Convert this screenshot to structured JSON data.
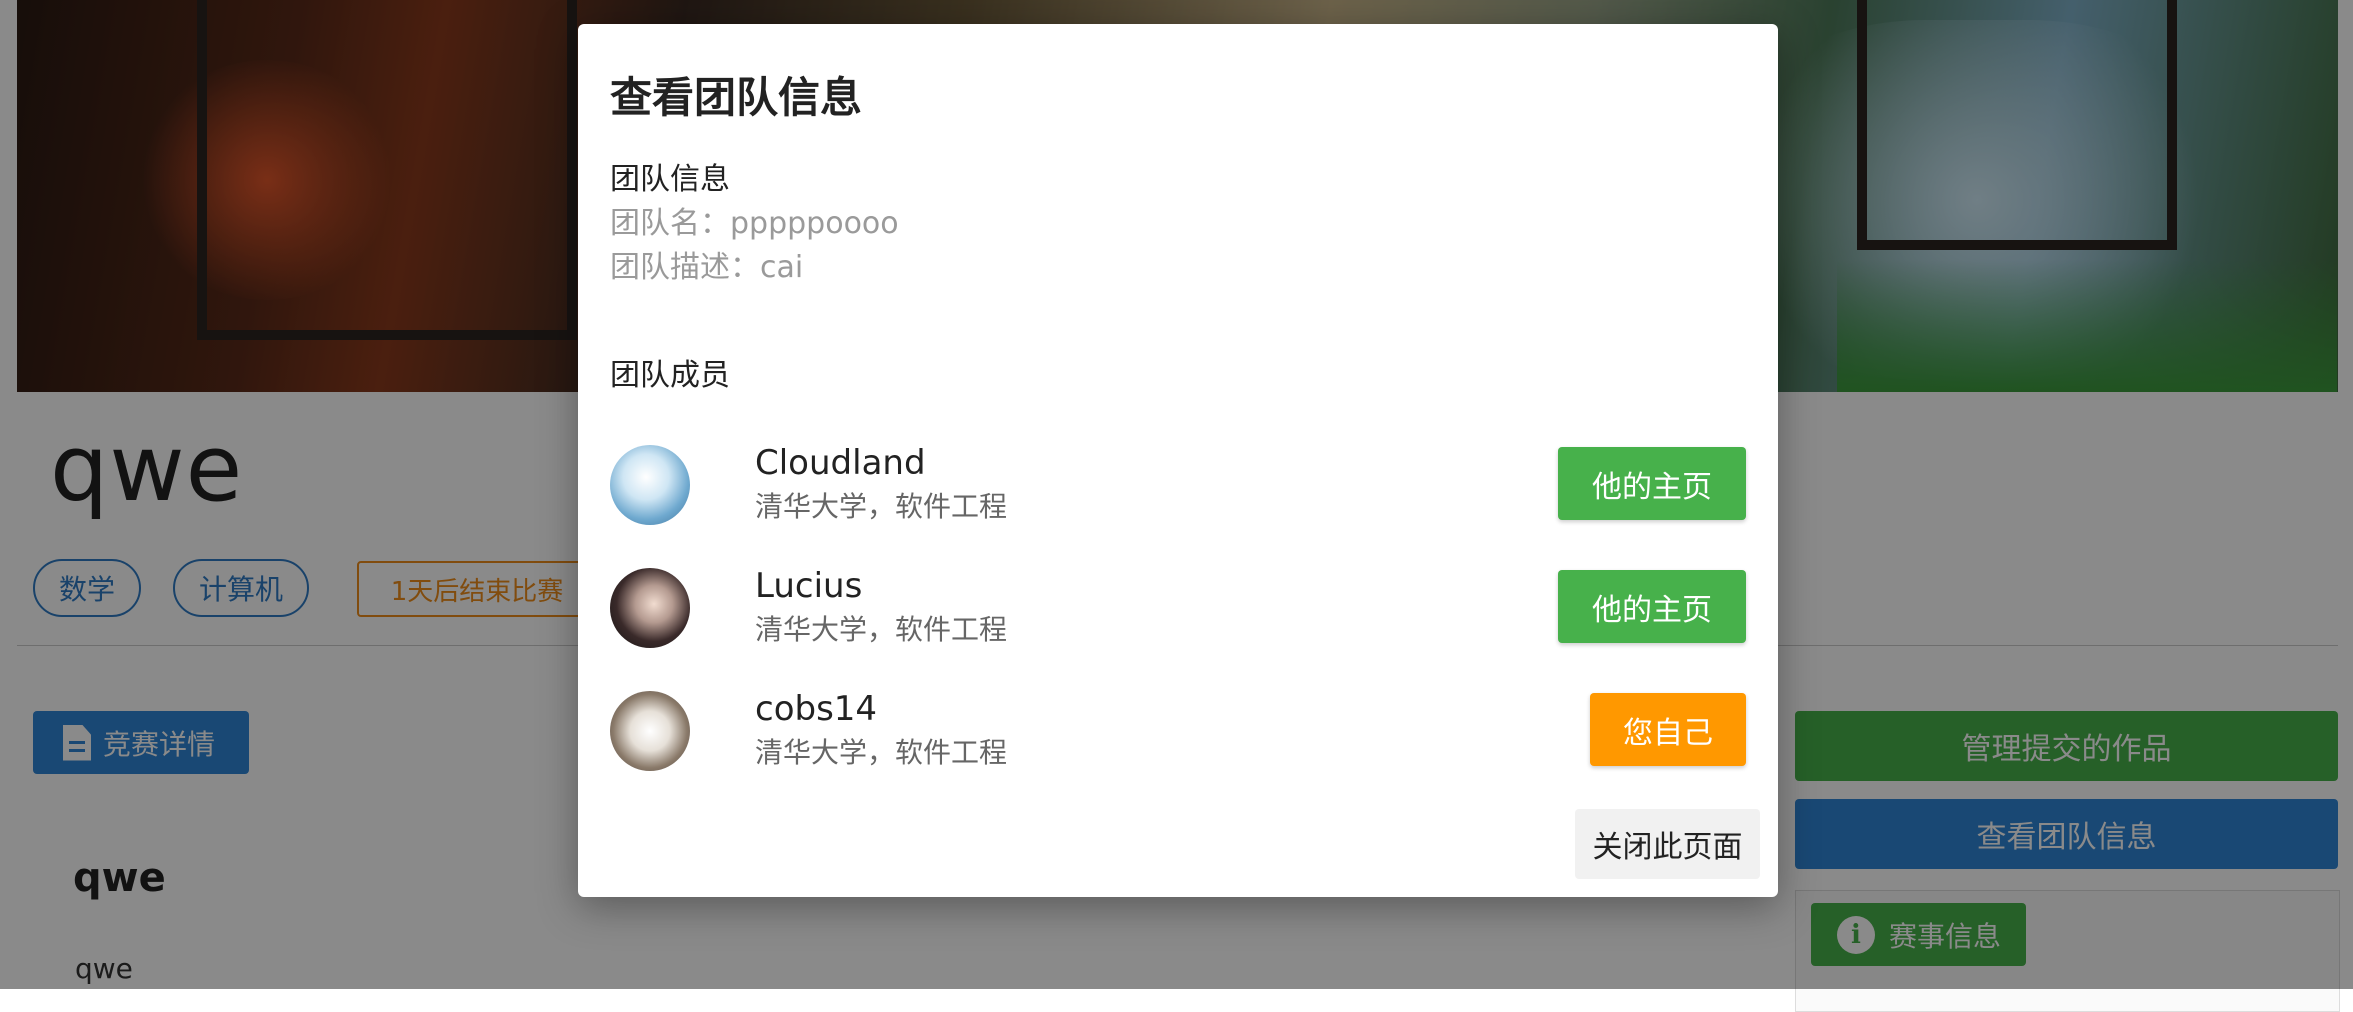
{
  "page": {
    "title": "qwe",
    "tags": [
      "数学",
      "计算机"
    ],
    "countdown": "1天后结束比赛",
    "detail_button": "竞赛详情",
    "section_title": "qwe",
    "section_body": "qwe"
  },
  "sidebar": {
    "manage_button": "管理提交的作品",
    "team_button": "查看团队信息",
    "info_button": "赛事信息"
  },
  "dialog": {
    "title": "查看团队信息",
    "team_info_label": "团队信息",
    "team_name": "团队名：pppppoooo",
    "team_desc": "团队描述：cai",
    "members_label": "团队成员",
    "members": [
      {
        "name": "Cloudland",
        "school": "清华大学，软件工程",
        "action": "他的主页",
        "action_color": "#47b14b"
      },
      {
        "name": "Lucius",
        "school": "清华大学，软件工程",
        "action": "他的主页",
        "action_color": "#47b14b"
      },
      {
        "name": "cobs14",
        "school": "清华大学，软件工程",
        "action": "您自己",
        "action_color": "#ff9800"
      }
    ],
    "close_button": "关闭此页面"
  },
  "colors": {
    "primary": "#2f86d6",
    "success": "#47b14b",
    "warning": "#ff9800"
  }
}
